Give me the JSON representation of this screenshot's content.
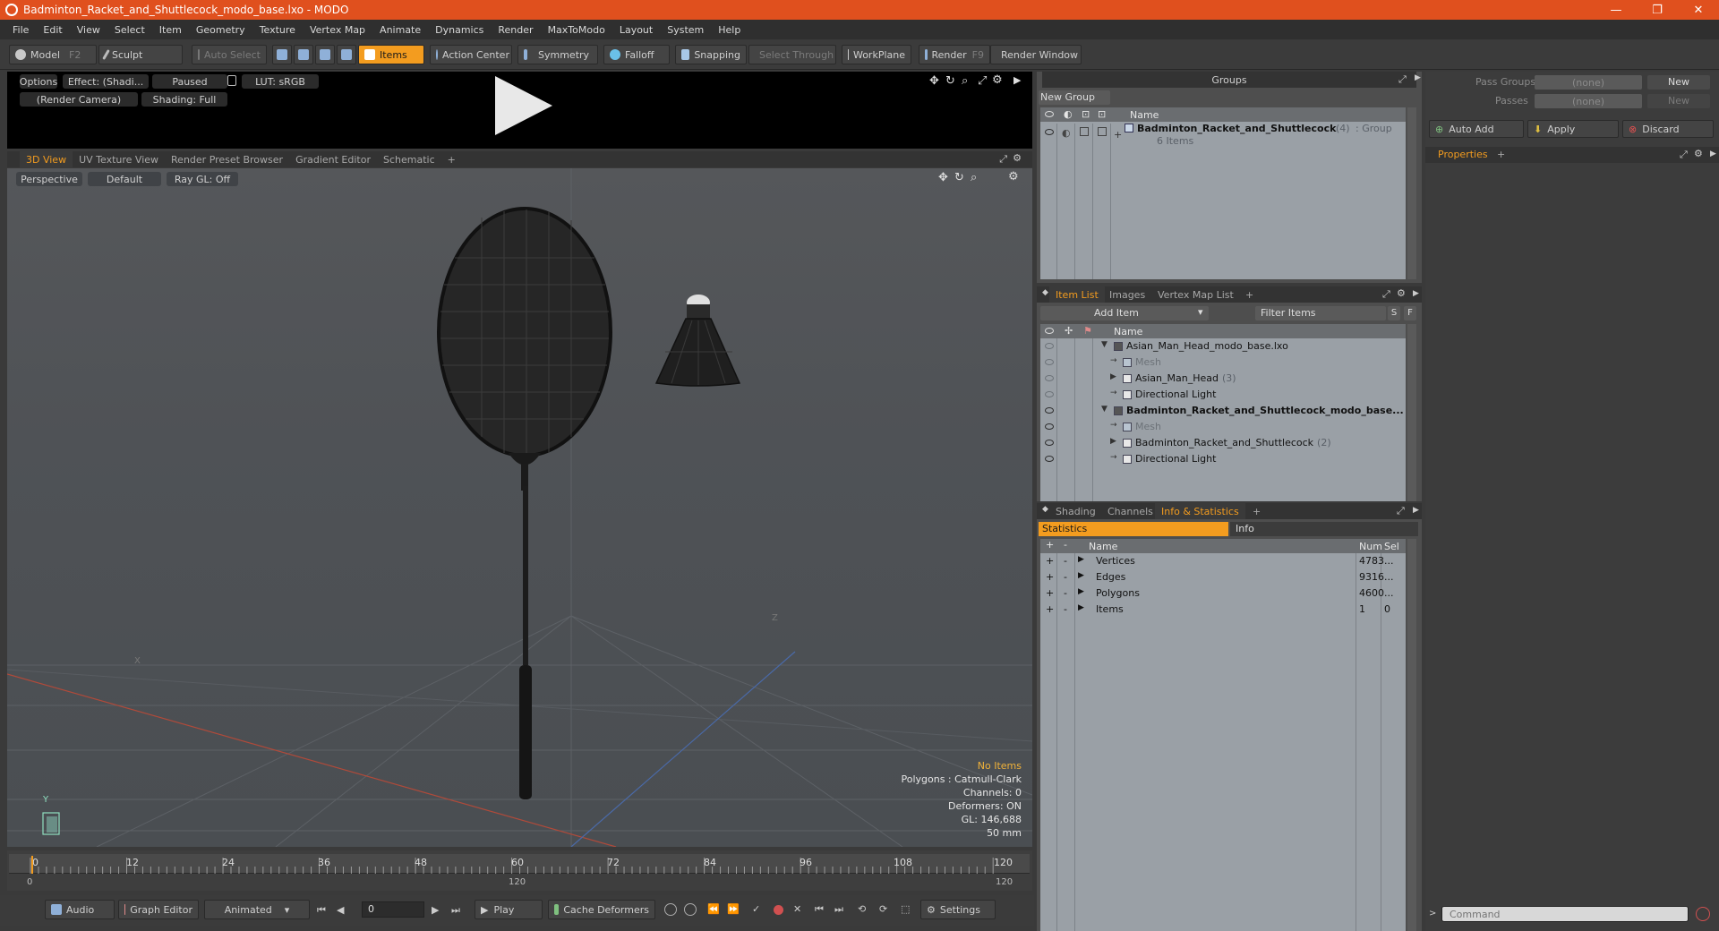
{
  "window": {
    "title": "Badminton_Racket_and_Shuttlecock_modo_base.lxo - MODO",
    "minimize": "—",
    "restore": "❐",
    "close": "✕"
  },
  "menu": [
    "File",
    "Edit",
    "View",
    "Select",
    "Item",
    "Geometry",
    "Texture",
    "Vertex Map",
    "Animate",
    "Dynamics",
    "Render",
    "MaxToModo",
    "Layout",
    "System",
    "Help"
  ],
  "toolbar": {
    "model": "Model",
    "model_key": "F2",
    "sculpt": "Sculpt",
    "auto_select": "Auto Select",
    "items": "Items",
    "action_center": "Action Center",
    "symmetry": "Symmetry",
    "falloff": "Falloff",
    "snapping": "Snapping",
    "select_through": "Select Through",
    "workplane": "WorkPlane",
    "render": "Render",
    "render_key": "F9",
    "render_window": "Render Window"
  },
  "preview": {
    "options": "Options",
    "effect": "Effect: (Shadi...",
    "paused": "Paused",
    "lut": "LUT: sRGB",
    "camera": "(Render Camera)",
    "shading": "Shading: Full"
  },
  "viewport_tabs": [
    "3D View",
    "UV Texture View",
    "Render Preset Browser",
    "Gradient Editor",
    "Schematic",
    "+"
  ],
  "viewport": {
    "perspective": "Perspective",
    "default": "Default",
    "raygl": "Ray GL: Off",
    "info": {
      "no_items": "No Items",
      "polygons": "Polygons : Catmull-Clark",
      "channels": "Channels: 0",
      "deformers": "Deformers: ON",
      "gl": "GL: 146,688",
      "lens": "50 mm"
    },
    "axis_x": "X",
    "axis_y": "Y",
    "axis_z": "Z"
  },
  "timeline": {
    "ticks": [
      "0",
      "12",
      "24",
      "36",
      "48",
      "60",
      "72",
      "84",
      "96",
      "108",
      "120"
    ],
    "range_start": "0",
    "range_mid": "120",
    "range_end": "120"
  },
  "bottombar": {
    "audio": "Audio",
    "graph_editor": "Graph Editor",
    "animated": "Animated",
    "frame": "0",
    "play": "Play",
    "cache_deformers": "Cache Deformers",
    "settings": "Settings"
  },
  "groups": {
    "header": "Groups",
    "new_group": "New Group",
    "col_name": "Name",
    "group_name": "Badminton_Racket_and_Shuttlecock",
    "group_count": "(4)",
    "group_type": ": Group",
    "group_items": "6 Items"
  },
  "passes": {
    "pass_groups_label": "Pass Groups",
    "pass_groups_value": "(none)",
    "passes_label": "Passes",
    "passes_value": "(none)",
    "new1": "New",
    "new2": "New",
    "auto_add": "Auto Add",
    "apply": "Apply",
    "discard": "Discard",
    "properties_tab": "Properties",
    "plus": "+"
  },
  "itemlist": {
    "tabs": [
      "Item List",
      "Images",
      "Vertex Map List",
      "+"
    ],
    "add_item": "Add Item",
    "filter": "Filter Items",
    "s": "S",
    "f": "F",
    "col_name": "Name",
    "rows": [
      {
        "label": "Asian_Man_Head_modo_base.lxo",
        "indent": 0,
        "bold": false,
        "gray": false,
        "count": ""
      },
      {
        "label": "Mesh",
        "indent": 1,
        "bold": false,
        "gray": true,
        "count": ""
      },
      {
        "label": "Asian_Man_Head",
        "indent": 1,
        "bold": false,
        "gray": false,
        "count": "(3)"
      },
      {
        "label": "Directional Light",
        "indent": 1,
        "bold": false,
        "gray": false,
        "count": ""
      },
      {
        "label": "Badminton_Racket_and_Shuttlecock_modo_base...",
        "indent": 0,
        "bold": true,
        "gray": false,
        "count": ""
      },
      {
        "label": "Mesh",
        "indent": 1,
        "bold": false,
        "gray": true,
        "count": ""
      },
      {
        "label": "Badminton_Racket_and_Shuttlecock",
        "indent": 1,
        "bold": false,
        "gray": false,
        "count": "(2)"
      },
      {
        "label": "Directional Light",
        "indent": 1,
        "bold": false,
        "gray": false,
        "count": ""
      }
    ]
  },
  "stats": {
    "tabs": [
      "Shading",
      "Channels",
      "Info & Statistics",
      "+"
    ],
    "sub_statistics": "Statistics",
    "sub_info": "Info",
    "col_name": "Name",
    "col_num": "Num",
    "col_sel": "Sel",
    "rows": [
      {
        "name": "Vertices",
        "num": "4783",
        "sel": "..."
      },
      {
        "name": "Edges",
        "num": "9316",
        "sel": "..."
      },
      {
        "name": "Polygons",
        "num": "4600",
        "sel": "..."
      },
      {
        "name": "Items",
        "num": "1",
        "sel": "0"
      }
    ]
  },
  "command": {
    "placeholder": "Command"
  }
}
